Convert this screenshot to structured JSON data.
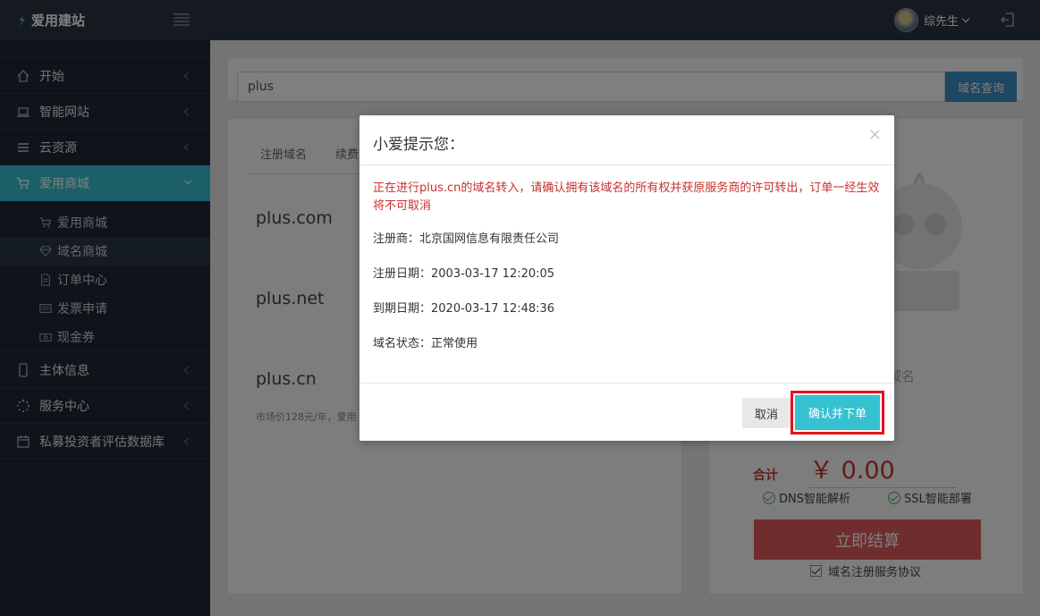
{
  "app": {
    "logo_text": "爱用建站"
  },
  "header": {
    "user_name": "综先生"
  },
  "sidebar": {
    "items": [
      {
        "label": "开始",
        "icon": "home-icon"
      },
      {
        "label": "智能网站",
        "icon": "laptop-icon"
      },
      {
        "label": "云资源",
        "icon": "list-icon"
      },
      {
        "label": "爱用商城",
        "icon": "cart-icon",
        "active": true
      },
      {
        "label": "主体信息",
        "icon": "phone-icon"
      },
      {
        "label": "服务中心",
        "icon": "spinner-icon"
      },
      {
        "label": "私募投资者评估数据库",
        "icon": "calendar-icon"
      }
    ],
    "sub_items": [
      {
        "label": "爱用商城",
        "icon": "cart-icon"
      },
      {
        "label": "域名商城",
        "icon": "diamond-icon"
      },
      {
        "label": "订单中心",
        "icon": "document-icon"
      },
      {
        "label": "发票申请",
        "icon": "invoice-icon"
      },
      {
        "label": "现金券",
        "icon": "cash-icon"
      }
    ]
  },
  "search": {
    "value": "plus",
    "button_label": "域名查询"
  },
  "tabs": [
    "注册域名",
    "续费"
  ],
  "domains": [
    "plus.com",
    "plus.net",
    "plus.cn"
  ],
  "market_price_text": "市场价128元/年，爱用",
  "cart": {
    "domain_label": "域名",
    "total_label": "合计",
    "total_amount": "￥ 0.00",
    "features": [
      "DNS智能解析",
      "SSL智能部署"
    ],
    "checkout_label": "立即结算",
    "agreement_label": "域名注册服务协议"
  },
  "modal": {
    "title": "小爱提示您：",
    "close_glyph": "×",
    "warning": "正在进行plus.cn的域名转入，请确认拥有该域名的所有权并获原服务商的许可转出，订单一经生效将不可取消",
    "registrar": "注册商：北京国网信息有限责任公司",
    "reg_date": "注册日期：2003-03-17 12:20:05",
    "exp_date": "到期日期：2020-03-17 12:48:36",
    "status": "域名状态：正常使用",
    "cancel_label": "取消",
    "confirm_label": "确认并下单"
  },
  "colors": {
    "accent": "#36c1d1",
    "sidebar_bg": "#1f2935",
    "topbar_bg": "#2b3543",
    "warning": "#c9302c",
    "highlight_frame": "#e4141a"
  }
}
